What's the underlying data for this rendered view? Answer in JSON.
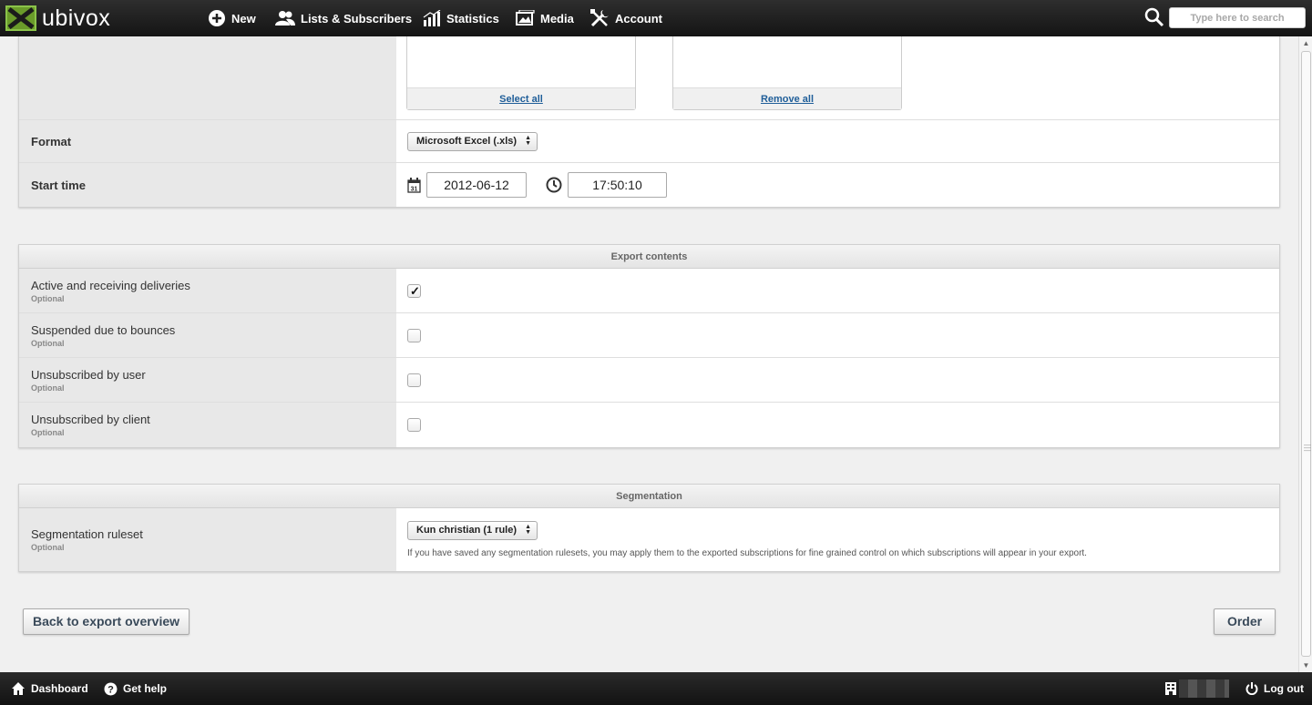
{
  "app": {
    "brand": "ubivox",
    "accent": "#6a9b2a"
  },
  "nav": {
    "new": "New",
    "lists": "Lists & Subscribers",
    "statistics": "Statistics",
    "media": "Media",
    "account": "Account"
  },
  "search": {
    "placeholder": "Type here to search"
  },
  "selection": {
    "select_all": "Select all",
    "remove_all": "Remove all"
  },
  "format": {
    "label": "Format",
    "value": "Microsoft Excel (.xls)"
  },
  "start_time": {
    "label": "Start time",
    "date": "2012-06-12",
    "time": "17:50:10",
    "calendar_day": "31"
  },
  "export_contents": {
    "title": "Export contents",
    "items": [
      {
        "label": "Active and receiving deliveries",
        "sub": "Optional",
        "checked": true
      },
      {
        "label": "Suspended due to bounces",
        "sub": "Optional",
        "checked": false
      },
      {
        "label": "Unsubscribed by user",
        "sub": "Optional",
        "checked": false
      },
      {
        "label": "Unsubscribed by client",
        "sub": "Optional",
        "checked": false
      }
    ]
  },
  "segmentation": {
    "title": "Segmentation",
    "label": "Segmentation ruleset",
    "sub": "Optional",
    "value": "Kun christian (1 rule)",
    "help": "If you have saved any segmentation rulesets, you may apply them to the exported subscriptions for fine grained control on which subscriptions will appear in your export."
  },
  "actions": {
    "back": "Back to export overview",
    "order": "Order"
  },
  "footer": {
    "dashboard": "Dashboard",
    "help": "Get help",
    "logout": "Log out"
  }
}
